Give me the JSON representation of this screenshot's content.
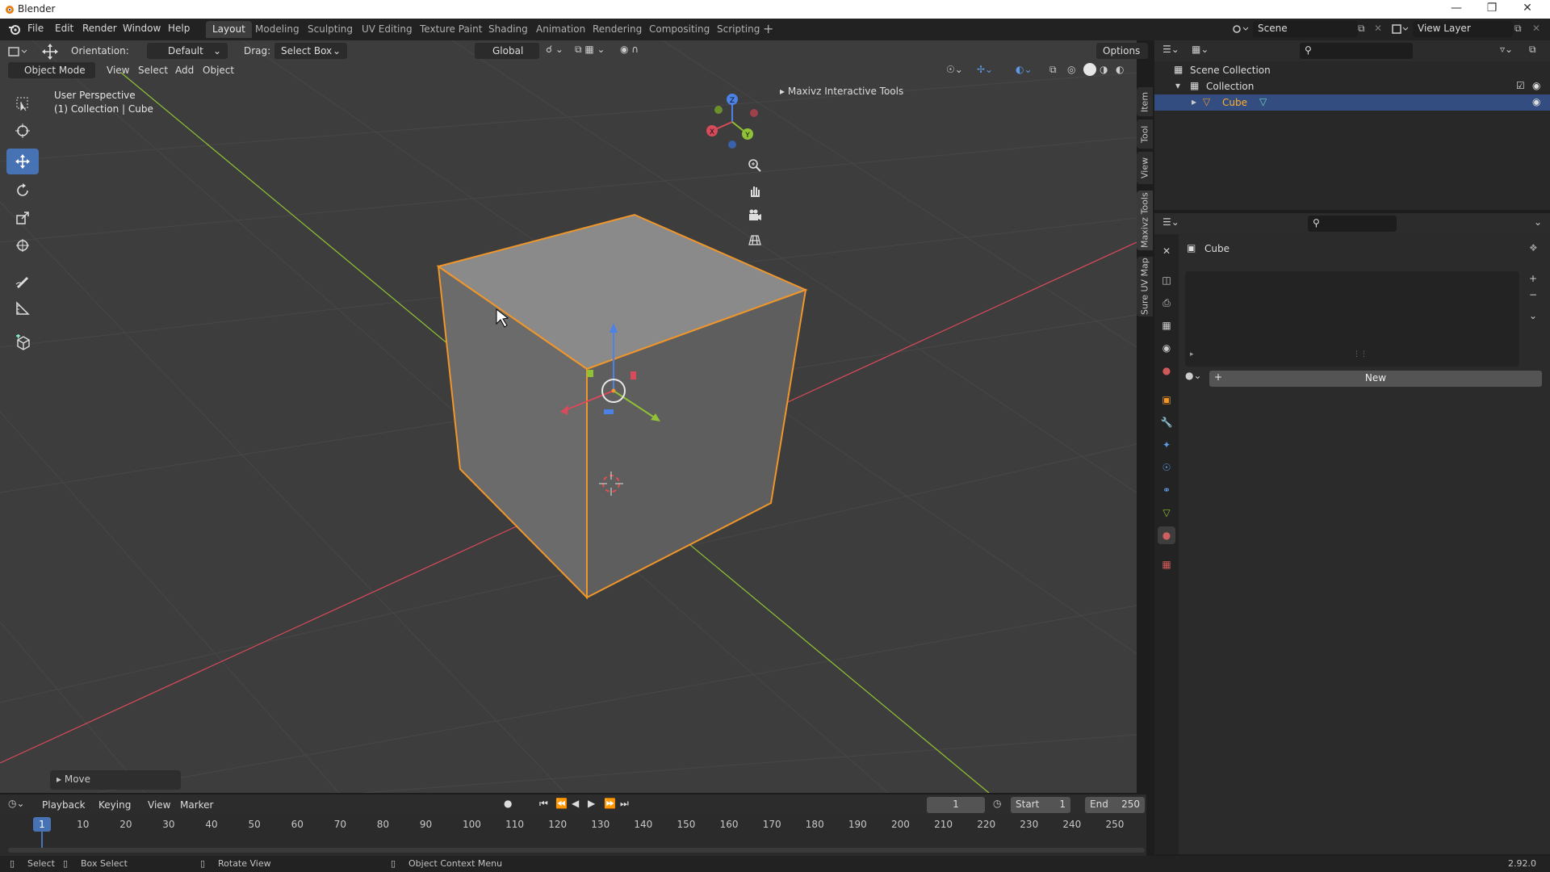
{
  "window": {
    "title": "Blender",
    "version": "2.92.0"
  },
  "menu": [
    "File",
    "Edit",
    "Render",
    "Window",
    "Help"
  ],
  "workspaces": [
    "Layout",
    "Modeling",
    "Sculpting",
    "UV Editing",
    "Texture Paint",
    "Shading",
    "Animation",
    "Rendering",
    "Compositing",
    "Scripting"
  ],
  "active_workspace": "Layout",
  "scene": {
    "name": "Scene",
    "view_layer": "View Layer"
  },
  "tool_header": {
    "orientation_label": "Orientation:",
    "orientation_value": "Default",
    "drag_label": "Drag:",
    "drag_value": "Select Box",
    "transform_space": "Global",
    "options": "Options"
  },
  "viewport_header": {
    "mode": "Object Mode",
    "menus": [
      "View",
      "Select",
      "Add",
      "Object"
    ]
  },
  "viewport": {
    "perspective": "User Perspective",
    "collection_info": "(1) Collection | Cube",
    "addon_panel": "Maxivz Interactive Tools",
    "last_op": "Move",
    "side_tabs": [
      "Item",
      "Tool",
      "View",
      "Maxivz Tools",
      "Sure UV Map"
    ]
  },
  "outliner": {
    "root": "Scene Collection",
    "collection": "Collection",
    "object": "Cube"
  },
  "properties": {
    "object_name": "Cube",
    "new_button": "New"
  },
  "timeline": {
    "menus": [
      "Playback",
      "Keying",
      "View",
      "Marker"
    ],
    "current_frame": "1",
    "start_label": "Start",
    "start_value": "1",
    "end_label": "End",
    "end_value": "250",
    "ticks": [
      "10",
      "20",
      "30",
      "40",
      "50",
      "60",
      "70",
      "80",
      "90",
      "100",
      "110",
      "120",
      "130",
      "140",
      "150",
      "160",
      "170",
      "180",
      "190",
      "200",
      "210",
      "220",
      "230",
      "240",
      "250"
    ],
    "current_marker": "1"
  },
  "statusbar": {
    "select": "Select",
    "box_select": "Box Select",
    "rotate_view": "Rotate View",
    "context_menu": "Object Context Menu"
  },
  "colors": {
    "accent": "#4772b3",
    "selection_outline": "#f0962a",
    "axis_x": "#d94a5a",
    "axis_y": "#8fc234",
    "axis_z": "#4c82e6"
  }
}
